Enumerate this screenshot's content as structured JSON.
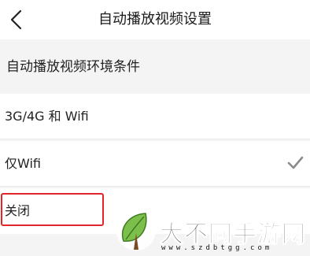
{
  "header": {
    "title": "自动播放视频设置",
    "back_icon": "chevron-left-icon"
  },
  "section": {
    "title": "自动播放视频环境条件"
  },
  "options": [
    {
      "label": "3G/4G 和 Wifi",
      "selected": false
    },
    {
      "label": "仅Wifi",
      "selected": true
    },
    {
      "label": "关闭",
      "selected": false
    }
  ],
  "check_icon": "checkmark-icon",
  "highlight": {
    "color": "#e0252b"
  },
  "watermark": {
    "name": "大不同手游网",
    "url": "www.szdbtgg.com",
    "logo_icon": "leaf-logo-icon"
  },
  "colors": {
    "background": "#f4f4f4",
    "row": "#ffffff",
    "check": "#8a8a8a"
  }
}
